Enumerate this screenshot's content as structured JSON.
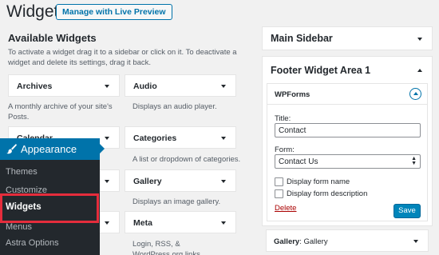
{
  "header": {
    "title": "Widgets",
    "live_preview_label": "Manage with Live Preview"
  },
  "available": {
    "title": "Available Widgets",
    "description": "To activate a widget drag it to a sidebar or click on it. To deactivate a widget and delete its settings, drag it back.",
    "widgets": [
      {
        "title": "Archives",
        "desc": "A monthly archive of your site's Posts."
      },
      {
        "title": "Audio",
        "desc": "Displays an audio player."
      },
      {
        "title": "Calendar",
        "desc": ""
      },
      {
        "title": "Categories",
        "desc": "A list or dropdown of categories."
      },
      {
        "title": "Gallery",
        "desc": "Displays an image gallery."
      },
      {
        "title": "Meta",
        "desc": "Login, RSS, & WordPress.org links."
      }
    ]
  },
  "sidebar": {
    "main_sidebar": "Main Sidebar",
    "footer_area": "Footer Widget Area 1",
    "wpforms": {
      "header": "WPForms",
      "title_label": "Title:",
      "title_value": "Contact",
      "form_label": "Form:",
      "form_selected": "Contact Us",
      "display_form_name": "Display form name",
      "display_form_description": "Display form description",
      "delete_label": "Delete",
      "save_label": "Save"
    },
    "gallery_widget_prefix": "Gallery",
    "gallery_widget_suffix": ": Gallery"
  },
  "admin_menu": {
    "appearance": "Appearance",
    "items": [
      "Themes",
      "Customize",
      "Widgets",
      "Menus",
      "Astra Options"
    ]
  },
  "colors": {
    "accent": "#0073aa",
    "menu_bg": "#23282d",
    "highlight_border": "#e52d3c",
    "delete_red": "#a00"
  },
  "icons": {
    "appearance": "paintbrush-icon",
    "wpforms_toggle": "chevron-up-circle-icon"
  }
}
